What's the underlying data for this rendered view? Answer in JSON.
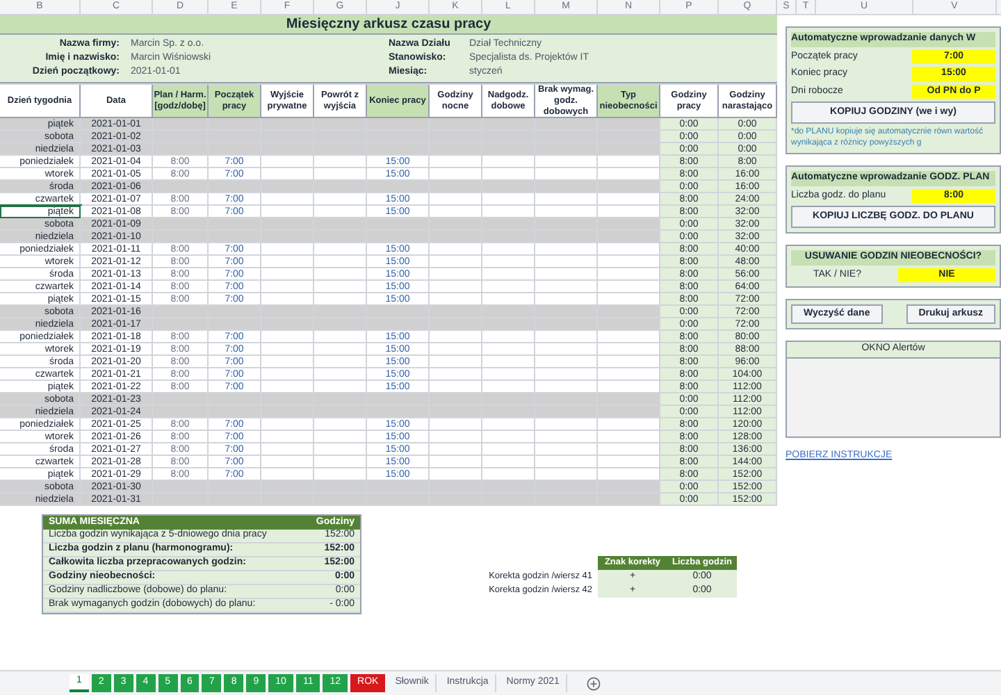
{
  "column_letters": [
    "B",
    "C",
    "D",
    "E",
    "F",
    "G",
    "J",
    "K",
    "L",
    "M",
    "N",
    "P",
    "Q",
    "S",
    "T",
    "U",
    "V"
  ],
  "title": "Miesięczny arkusz czasu pracy",
  "info_left": [
    {
      "label": "Nazwa firmy:",
      "value": "Marcin Sp. z o.o."
    },
    {
      "label": "Imię i nazwisko:",
      "value": "Marcin Wiśniowski"
    },
    {
      "label": "Dzień początkowy:",
      "value": "2021-01-01"
    }
  ],
  "info_right": [
    {
      "label": "Nazwa Działu",
      "value": "Dział Techniczny"
    },
    {
      "label": "Stanowisko:",
      "value": "Specjalista ds. Projektów IT"
    },
    {
      "label": "Miesiąc:",
      "value": "styczeń"
    }
  ],
  "columns": [
    {
      "label": "Dzień tygodnia",
      "highlighted": false
    },
    {
      "label": "Data",
      "highlighted": false
    },
    {
      "label": "Plan / Harm. [godz/dobę]",
      "highlighted": true
    },
    {
      "label": "Początek pracy",
      "highlighted": true
    },
    {
      "label": "Wyjście prywatne",
      "highlighted": false
    },
    {
      "label": "Powrót z wyjścia",
      "highlighted": false
    },
    {
      "label": "Koniec pracy",
      "highlighted": true
    },
    {
      "label": "Godziny nocne",
      "highlighted": false
    },
    {
      "label": "Nadgodz. dobowe",
      "highlighted": false
    },
    {
      "label": "Brak wymag. godz. dobowych",
      "highlighted": false
    },
    {
      "label": "Typ nieobecności",
      "highlighted": true
    },
    {
      "label": "Godziny pracy",
      "highlighted": false
    },
    {
      "label": "Godziny narastająco",
      "highlighted": false
    }
  ],
  "rows": [
    {
      "day": "piątek",
      "date": "2021-01-01",
      "shaded": true,
      "selected": false,
      "hours": "0:00",
      "total": "0:00"
    },
    {
      "day": "sobota",
      "date": "2021-01-02",
      "shaded": true,
      "selected": false,
      "hours": "0:00",
      "total": "0:00"
    },
    {
      "day": "niedziela",
      "date": "2021-01-03",
      "shaded": true,
      "selected": false,
      "hours": "0:00",
      "total": "0:00"
    },
    {
      "day": "poniedziałek",
      "date": "2021-01-04",
      "shaded": false,
      "selected": false,
      "plan": "8:00",
      "start": "7:00",
      "end": "15:00",
      "hours": "8:00",
      "total": "8:00"
    },
    {
      "day": "wtorek",
      "date": "2021-01-05",
      "shaded": false,
      "selected": false,
      "plan": "8:00",
      "start": "7:00",
      "end": "15:00",
      "hours": "8:00",
      "total": "16:00"
    },
    {
      "day": "środa",
      "date": "2021-01-06",
      "shaded": true,
      "selected": false,
      "hours": "0:00",
      "total": "16:00"
    },
    {
      "day": "czwartek",
      "date": "2021-01-07",
      "shaded": false,
      "selected": false,
      "plan": "8:00",
      "start": "7:00",
      "end": "15:00",
      "hours": "8:00",
      "total": "24:00"
    },
    {
      "day": "piątek",
      "date": "2021-01-08",
      "shaded": false,
      "selected": true,
      "plan": "8:00",
      "start": "7:00",
      "end": "15:00",
      "hours": "8:00",
      "total": "32:00"
    },
    {
      "day": "sobota",
      "date": "2021-01-09",
      "shaded": true,
      "selected": false,
      "hours": "0:00",
      "total": "32:00"
    },
    {
      "day": "niedziela",
      "date": "2021-01-10",
      "shaded": true,
      "selected": false,
      "hours": "0:00",
      "total": "32:00"
    },
    {
      "day": "poniedziałek",
      "date": "2021-01-11",
      "shaded": false,
      "selected": false,
      "plan": "8:00",
      "start": "7:00",
      "end": "15:00",
      "hours": "8:00",
      "total": "40:00"
    },
    {
      "day": "wtorek",
      "date": "2021-01-12",
      "shaded": false,
      "selected": false,
      "plan": "8:00",
      "start": "7:00",
      "end": "15:00",
      "hours": "8:00",
      "total": "48:00"
    },
    {
      "day": "środa",
      "date": "2021-01-13",
      "shaded": false,
      "selected": false,
      "plan": "8:00",
      "start": "7:00",
      "end": "15:00",
      "hours": "8:00",
      "total": "56:00"
    },
    {
      "day": "czwartek",
      "date": "2021-01-14",
      "shaded": false,
      "selected": false,
      "plan": "8:00",
      "start": "7:00",
      "end": "15:00",
      "hours": "8:00",
      "total": "64:00"
    },
    {
      "day": "piątek",
      "date": "2021-01-15",
      "shaded": false,
      "selected": false,
      "plan": "8:00",
      "start": "7:00",
      "end": "15:00",
      "hours": "8:00",
      "total": "72:00"
    },
    {
      "day": "sobota",
      "date": "2021-01-16",
      "shaded": true,
      "selected": false,
      "hours": "0:00",
      "total": "72:00"
    },
    {
      "day": "niedziela",
      "date": "2021-01-17",
      "shaded": true,
      "selected": false,
      "hours": "0:00",
      "total": "72:00"
    },
    {
      "day": "poniedziałek",
      "date": "2021-01-18",
      "shaded": false,
      "selected": false,
      "plan": "8:00",
      "start": "7:00",
      "end": "15:00",
      "hours": "8:00",
      "total": "80:00"
    },
    {
      "day": "wtorek",
      "date": "2021-01-19",
      "shaded": false,
      "selected": false,
      "plan": "8:00",
      "start": "7:00",
      "end": "15:00",
      "hours": "8:00",
      "total": "88:00"
    },
    {
      "day": "środa",
      "date": "2021-01-20",
      "shaded": false,
      "selected": false,
      "plan": "8:00",
      "start": "7:00",
      "end": "15:00",
      "hours": "8:00",
      "total": "96:00"
    },
    {
      "day": "czwartek",
      "date": "2021-01-21",
      "shaded": false,
      "selected": false,
      "plan": "8:00",
      "start": "7:00",
      "end": "15:00",
      "hours": "8:00",
      "total": "104:00"
    },
    {
      "day": "piątek",
      "date": "2021-01-22",
      "shaded": false,
      "selected": false,
      "plan": "8:00",
      "start": "7:00",
      "end": "15:00",
      "hours": "8:00",
      "total": "112:00"
    },
    {
      "day": "sobota",
      "date": "2021-01-23",
      "shaded": true,
      "selected": false,
      "hours": "0:00",
      "total": "112:00"
    },
    {
      "day": "niedziela",
      "date": "2021-01-24",
      "shaded": true,
      "selected": false,
      "hours": "0:00",
      "total": "112:00"
    },
    {
      "day": "poniedziałek",
      "date": "2021-01-25",
      "shaded": false,
      "selected": false,
      "plan": "8:00",
      "start": "7:00",
      "end": "15:00",
      "hours": "8:00",
      "total": "120:00"
    },
    {
      "day": "wtorek",
      "date": "2021-01-26",
      "shaded": false,
      "selected": false,
      "plan": "8:00",
      "start": "7:00",
      "end": "15:00",
      "hours": "8:00",
      "total": "128:00"
    },
    {
      "day": "środa",
      "date": "2021-01-27",
      "shaded": false,
      "selected": false,
      "plan": "8:00",
      "start": "7:00",
      "end": "15:00",
      "hours": "8:00",
      "total": "136:00"
    },
    {
      "day": "czwartek",
      "date": "2021-01-28",
      "shaded": false,
      "selected": false,
      "plan": "8:00",
      "start": "7:00",
      "end": "15:00",
      "hours": "8:00",
      "total": "144:00"
    },
    {
      "day": "piątek",
      "date": "2021-01-29",
      "shaded": false,
      "selected": false,
      "plan": "8:00",
      "start": "7:00",
      "end": "15:00",
      "hours": "8:00",
      "total": "152:00"
    },
    {
      "day": "sobota",
      "date": "2021-01-30",
      "shaded": true,
      "selected": false,
      "hours": "0:00",
      "total": "152:00"
    },
    {
      "day": "niedziela",
      "date": "2021-01-31",
      "shaded": true,
      "selected": false,
      "hours": "0:00",
      "total": "152:00"
    }
  ],
  "summary": {
    "title": "SUMA MIESIĘCZNA",
    "column": "Godziny",
    "rows": [
      {
        "label": "Liczba godzin wynikająca z 5-dniowego dnia pracy",
        "value": "152:00",
        "bold": false
      },
      {
        "label": "Liczba godzin z planu (harmonogramu):",
        "value": "152:00",
        "bold": true
      },
      {
        "label": "Całkowita liczba przepracowanych godzin:",
        "value": "152:00",
        "bold": true
      },
      {
        "label": "Godziny nieobecności:",
        "value": "0:00",
        "bold": true
      },
      {
        "label": "Godziny nadliczbowe (dobowe) do planu:",
        "value": "0:00",
        "bold": false
      },
      {
        "label": "Brak wymaganych godzin (dobowych) do planu:",
        "value": "- 0:00",
        "bold": false
      }
    ]
  },
  "corrections": {
    "columns": [
      "Znak korekty",
      "Liczba godzin"
    ],
    "rows": [
      {
        "label": "Korekta godzin /wiersz 41",
        "sign": "+",
        "value": "0:00"
      },
      {
        "label": "Korekta godzin /wiersz 42",
        "sign": "+",
        "value": "0:00"
      }
    ]
  },
  "auto_panel": {
    "title": "Automatyczne wprowadzanie danych W",
    "fields": [
      {
        "label": "Początek pracy",
        "value": "7:00"
      },
      {
        "label": "Koniec pracy",
        "value": "15:00"
      },
      {
        "label": "Dni robocze",
        "value": "Od PN do P"
      }
    ],
    "button": "KOPIUJ GODZINY (we i wy)",
    "note": "*do PLANU kopiuje się automatycznie równ wartość wynikająca z różnicy powyższych g"
  },
  "plan_panel": {
    "title": "Automatyczne wprowadzanie GODZ. PLAN",
    "label": "Liczba godz. do planu",
    "value": "8:00",
    "button": "KOPIUJ LICZBĘ GODZ. DO PLANU"
  },
  "absence_panel": {
    "title": "USUWANIE GODZIN NIEOBECNOŚCI?",
    "label": "TAK / NIE?",
    "value": "NIE"
  },
  "action_buttons": [
    "Wyczyść dane",
    "Drukuj arkusz"
  ],
  "alerts_title": "OKNO Alertów",
  "instructions_link": "POBIERZ INSTRUKCJE",
  "sheet_tabs": [
    {
      "label": "1",
      "kind": "month",
      "selected": true
    },
    {
      "label": "2",
      "kind": "month",
      "selected": false
    },
    {
      "label": "3",
      "kind": "month",
      "selected": false
    },
    {
      "label": "4",
      "kind": "month",
      "selected": false
    },
    {
      "label": "5",
      "kind": "month",
      "selected": false
    },
    {
      "label": "6",
      "kind": "month",
      "selected": false
    },
    {
      "label": "7",
      "kind": "month",
      "selected": false
    },
    {
      "label": "8",
      "kind": "month",
      "selected": false
    },
    {
      "label": "9",
      "kind": "month",
      "selected": false
    },
    {
      "label": "10",
      "kind": "month",
      "selected": false
    },
    {
      "label": "11",
      "kind": "month",
      "selected": false
    },
    {
      "label": "12",
      "kind": "month",
      "selected": false
    },
    {
      "label": "ROK",
      "kind": "year",
      "selected": false
    },
    {
      "label": "Słownik",
      "kind": "sheet",
      "selected": false
    },
    {
      "label": "Instrukcja",
      "kind": "sheet",
      "selected": false
    },
    {
      "label": "Normy 2021",
      "kind": "sheet",
      "selected": false
    }
  ]
}
